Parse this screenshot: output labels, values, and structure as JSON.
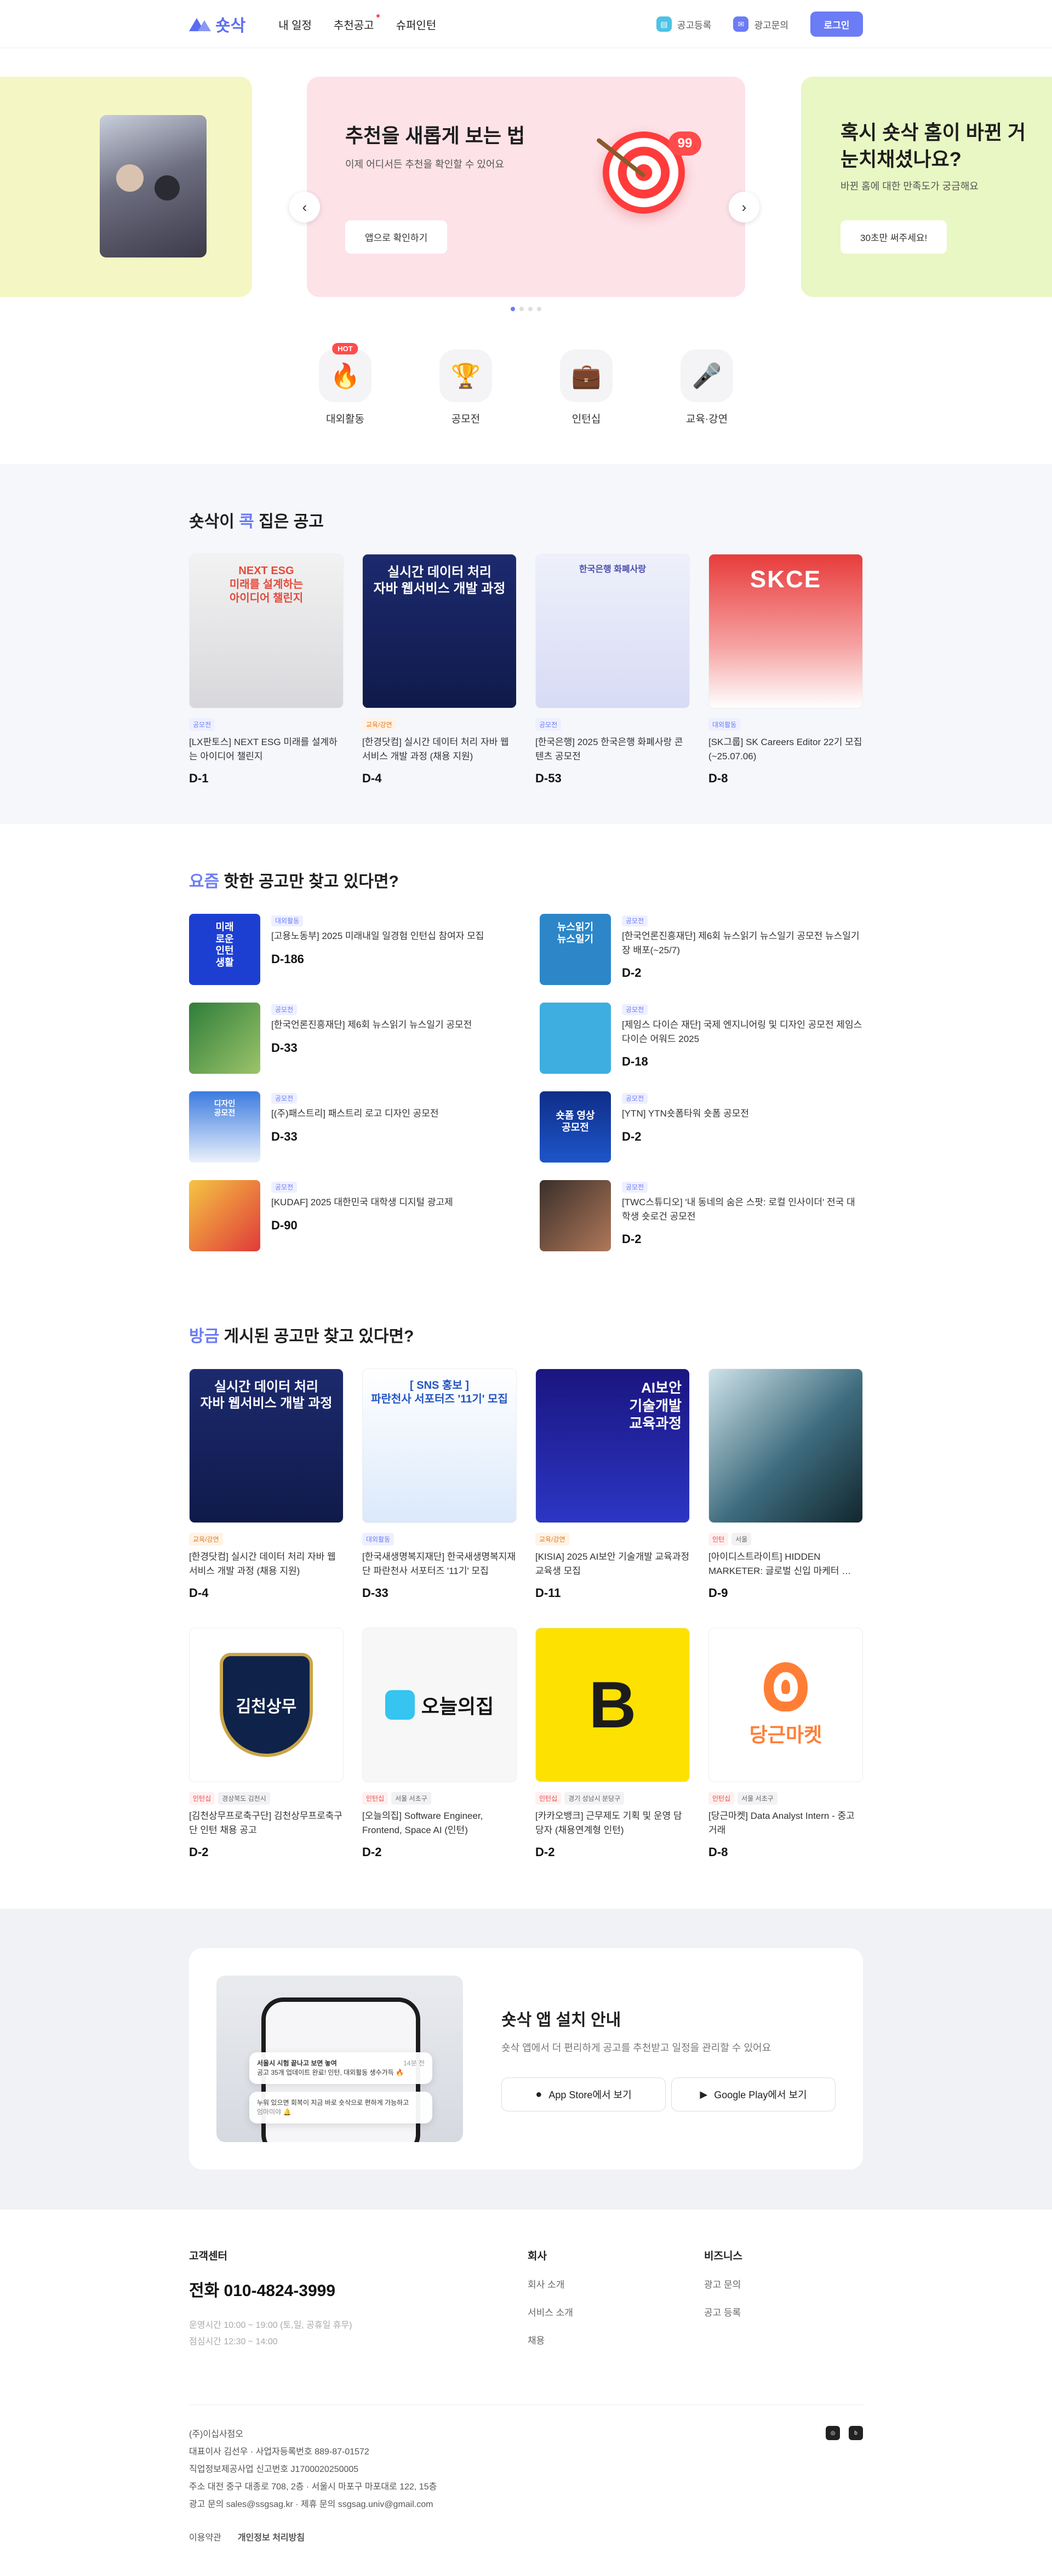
{
  "header": {
    "logo_text": "숏삭",
    "nav": [
      "내 일정",
      "추천공고",
      "슈퍼인턴"
    ],
    "ad_register": "공고등록",
    "ad_inquiry": "광고문의",
    "login": "로그인"
  },
  "banner": {
    "left": {
      "title": "",
      "desc": ""
    },
    "center": {
      "title": "추천을 새롭게 보는 법",
      "desc": "이제 어디서든 추천을 확인할 수 있어요",
      "button": "앱으로 확인하기",
      "badge": "99"
    },
    "right": {
      "title": "혹시 숏삭 홈이 바뀐 거\n눈치채셨나요?",
      "desc": "바뀐 홈에 대한 만족도가 궁금해요",
      "button": "30초만 써주세요!"
    },
    "prev": "‹",
    "next": "›"
  },
  "categories": [
    {
      "label": "대외활동",
      "icon": "fire-icon",
      "hot": "HOT"
    },
    {
      "label": "공모전",
      "icon": "trophy-icon"
    },
    {
      "label": "인턴십",
      "icon": "briefcase-icon"
    },
    {
      "label": "교육·강연",
      "icon": "microphone-icon"
    }
  ],
  "picked": {
    "title_pre": "숏삭이 ",
    "title_hl": "콕",
    "title_post": " 집은 공고",
    "items": [
      {
        "tag": "공모전",
        "title": "[LX판토스] NEXT ESG 미래를 설계하는 아이디어 챌린지",
        "dday": "D-1",
        "img_text": "NEXT ESG\n미래를 설계하는\n아이디어 챌린지"
      },
      {
        "tag": "교육/강연",
        "title": "[한경닷컴] 실시간 데이터 처리 자바 웹 서비스 개발 과정 (채용 지원)",
        "dday": "D-4",
        "img_text": "실시간 데이터 처리\n자바 웹서비스 개발 과정"
      },
      {
        "tag": "공모전",
        "title": "[한국은행] 2025 한국은행 화폐사랑 콘텐츠 공모전",
        "dday": "D-53",
        "img_text": "한국은행 화폐사랑"
      },
      {
        "tag": "대외활동",
        "title": "[SK그룹] SK Careers Editor 22기 모집(~25.07.06)",
        "dday": "D-8",
        "img_text": "SKCE"
      }
    ]
  },
  "hot": {
    "title_hl": "요즘",
    "title_post": " 핫한 공고만 찾고 있다면?",
    "items": [
      {
        "tag": "대외활동",
        "title": "[고용노동부] 2025 미래내일 일경험 인턴십 참여자 모집",
        "dday": "D-186",
        "img_text": "미래\n로운\n인턴\n생활"
      },
      {
        "tag": "공모전",
        "title": "[한국언론진흥재단] 제6회 뉴스읽기 뉴스일기 공모전 뉴스일기장 배포(~25/7)",
        "dday": "D-2",
        "img_text": "뉴스읽기\n뉴스일기"
      },
      {
        "tag": "공모전",
        "title": "[한국언론진흥재단] 제6회 뉴스읽기 뉴스일기 공모전",
        "dday": "D-33",
        "img_text": ""
      },
      {
        "tag": "공모전",
        "title": "[제임스 다이슨 재단] 국제 엔지니어링 및 디자인 공모전 제임스 다이슨 어워드 2025",
        "dday": "D-18",
        "img_text": ""
      },
      {
        "tag": "공모전",
        "title": "[(주)패스트리] 패스트리 로고 디자인 공모전",
        "dday": "D-33",
        "img_text": "디자인\n공모전"
      },
      {
        "tag": "공모전",
        "title": "[YTN] YTN숏폼타워 숏폼 공모전",
        "dday": "D-2",
        "img_text": "숏폼 영상\n공모전"
      },
      {
        "tag": "공모전",
        "title": "[KUDAF] 2025 대한민국 대학생 디지털 광고제",
        "dday": "D-90",
        "img_text": ""
      },
      {
        "tag": "공모전",
        "title": "[TWC스튜디오] '내 동네의 숨은 스팟: 로컬 인사이더' 전국 대학생 숏로건 공모전",
        "dday": "D-2",
        "img_text": ""
      }
    ]
  },
  "recent": {
    "title_hl": "방금",
    "title_post": " 게시된 공고만 찾고 있다면?",
    "items": [
      {
        "tags": [
          "교육/강연"
        ],
        "title": "[한경닷컴] 실시간 데이터 처리 자바 웹 서비스 개발 과정 (채용 지원)",
        "dday": "D-4",
        "img_text": "실시간 데이터 처리\n자바 웹서비스 개발 과정"
      },
      {
        "tags": [
          "대외활동"
        ],
        "title": "[한국새생명복지재단] 한국새생명복지재단 파란천사 서포터즈 '11기' 모집",
        "dday": "D-33",
        "img_text": "[ SNS 홍보 ]\n파란천사 서포터즈 '11기' 모집"
      },
      {
        "tags": [
          "교육/강연"
        ],
        "title": "[KISIA] 2025 AI보안 기술개발 교육과정 교육생 모집",
        "dday": "D-11",
        "img_text": "AI보안\n기술개발\n교육과정"
      },
      {
        "tags": [
          "인턴",
          "서울"
        ],
        "title": "[아이디스트라이트] HIDDEN MARKETER: 글로벌 신입 마케터 …",
        "dday": "D-9",
        "img_text": ""
      },
      {
        "tags": [
          "인턴십",
          "경상북도 김천시"
        ],
        "title": "[김천상무프로축구단] 김천상무프로축구단 인턴 채용 공고",
        "dday": "D-2",
        "img_text": "김천상무"
      },
      {
        "tags": [
          "인턴십",
          "서울 서초구"
        ],
        "title": "[오늘의집] Software Engineer, Frontend, Space AI (인턴)",
        "dday": "D-2",
        "img_text": "오늘의집"
      },
      {
        "tags": [
          "인턴십",
          "경기 성남시 분당구"
        ],
        "title": "[카카오뱅크] 근무제도 기획 및 운영 담당자 (채용연계형 인턴)",
        "dday": "D-2",
        "img_text": "B"
      },
      {
        "tags": [
          "인턴십",
          "서울 서초구"
        ],
        "title": "[당근마켓] Data Analyst Intern - 중고거래",
        "dday": "D-8",
        "img_text": "당근마켓"
      }
    ]
  },
  "app": {
    "title": "숏삭 앱 설치 안내",
    "desc": "숏삭 앱에서 더 편리하게 공고를 추천받고 일정을 관리할 수 있어요",
    "appstore": "App Store에서 보기",
    "googleplay": "Google Play에서 보기",
    "notif1_title": "서울시 시험 끝나고 보면 놓여",
    "notif1_time": "14분 전",
    "notif1_body": "공고 35개 업데이트 완료! 인턴, 대외활동 생수가득 🔥",
    "notif2_body": "누워 있으면 회복이 지금 바로 숏삭으로 편하게 가능하고",
    "notif2_sub": "엄마미야 🔔"
  },
  "footer": {
    "cs_title": "고객센터",
    "phone": "전화 010-4824-3999",
    "hours": "운영시간 10:00 ~ 19:00 (토,일, 공휴일 휴무)",
    "lunch": "점심시간 12:30 ~ 14:00",
    "company_title": "회사",
    "company_links": [
      "회사 소개",
      "서비스 소개",
      "채용"
    ],
    "biz_title": "비즈니스",
    "biz_links": [
      "광고 문의",
      "공고 등록"
    ],
    "corp": "(주)이십사점오",
    "ceo": "대표이사 김선우 · 사업자등록번호 889-87-01572",
    "mail_order": "직업정보제공사업 신고번호 J1700020250005",
    "address": "주소 대전 중구 대종로 708, 2층 · 서울시 마포구 마포대로 122, 15층",
    "contact": "광고 문의 sales@ssgsag.kr · 제휴 문의 ssgsag.univ@gmail.com",
    "terms": "이용약관",
    "privacy": "개인정보 처리방침",
    "sns": [
      "instagram-icon",
      "blog-icon"
    ]
  }
}
